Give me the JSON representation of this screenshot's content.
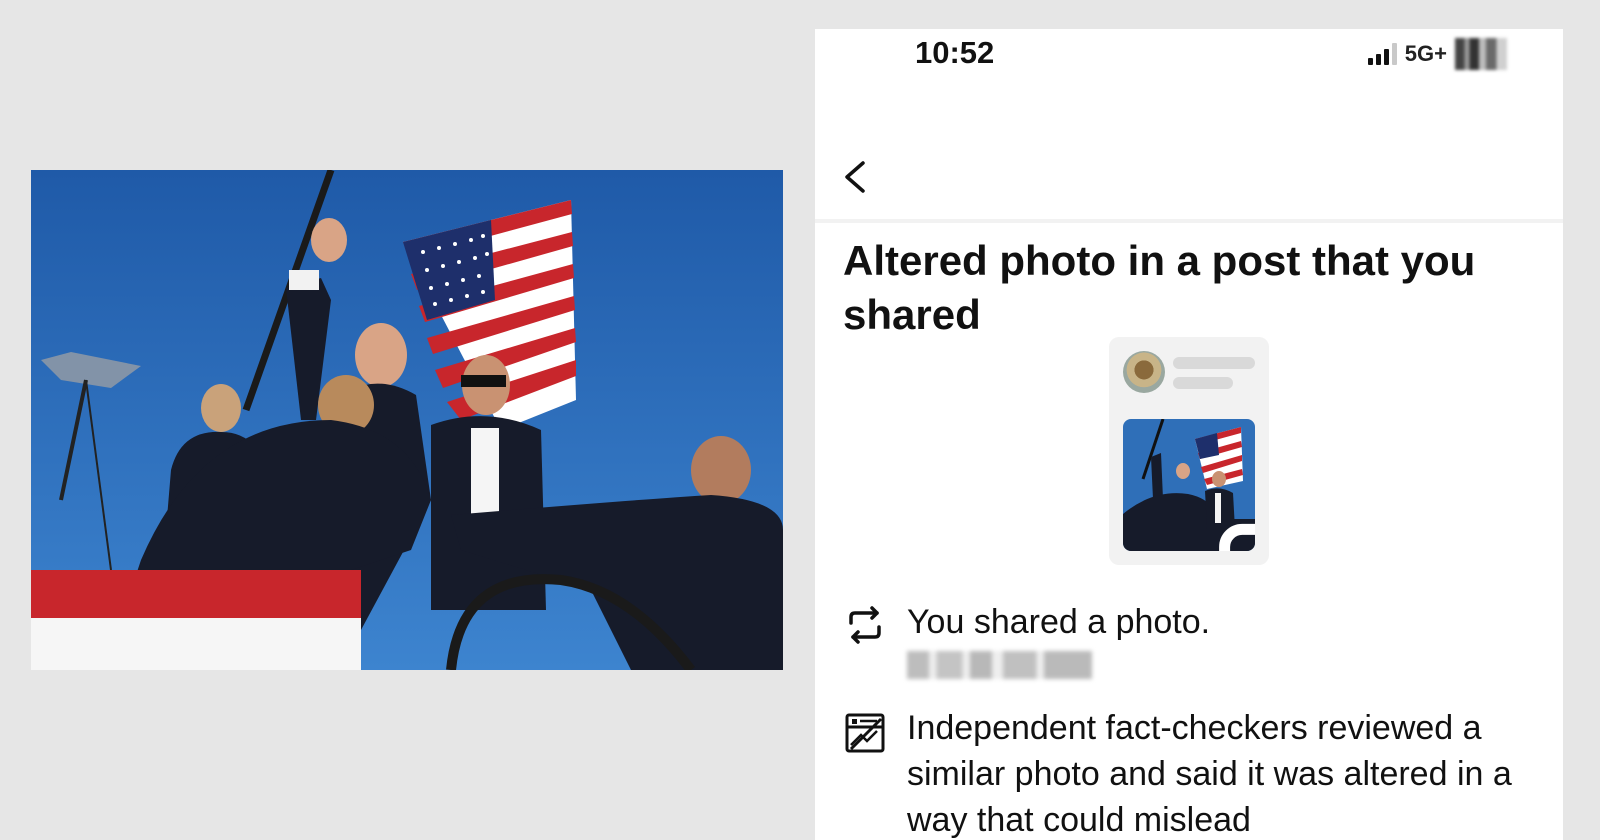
{
  "photo": {
    "alt_subject": "rally-photo"
  },
  "phone": {
    "status_bar": {
      "time": "10:52",
      "network": "5G+"
    },
    "nav": {
      "back_icon": "chevron-left-icon"
    },
    "heading": "Altered photo in a post that you shared",
    "preview": {
      "image_icon": "image-overlay-icon"
    },
    "rows": [
      {
        "icon": "repost-icon",
        "text": "You shared a photo."
      },
      {
        "icon": "fact-check-icon",
        "text": "Independent fact-checkers reviewed a similar photo and said it was altered in a way that could mislead"
      }
    ]
  },
  "colors": {
    "sky": "#2f6fb8",
    "flag_red": "#c8262c",
    "suit": "#171c2b",
    "page_bg": "#e6e6e6"
  }
}
